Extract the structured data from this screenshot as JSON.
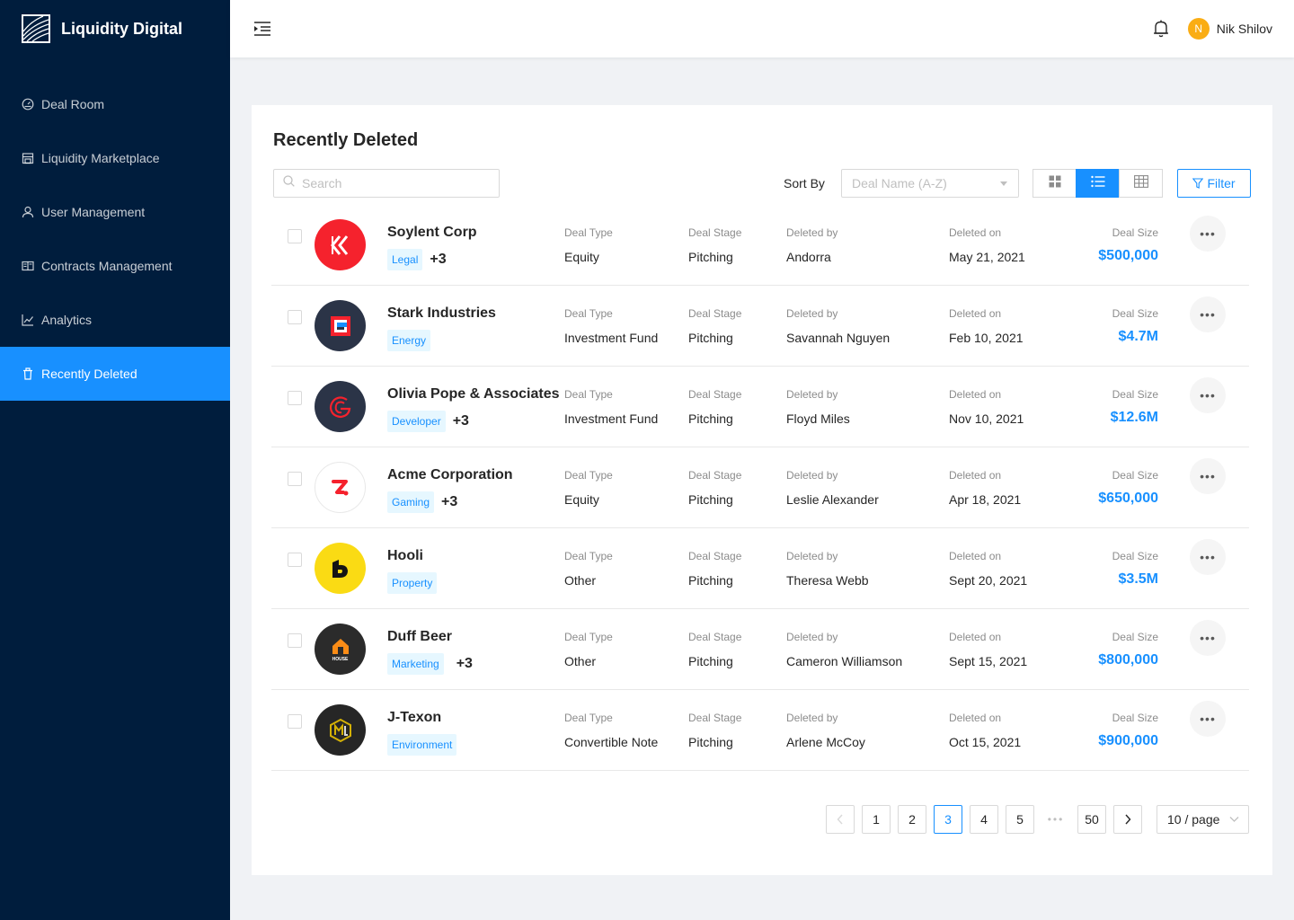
{
  "app": {
    "name": "Liquidity Digital"
  },
  "sidebar": {
    "items": [
      {
        "label": "Deal Room",
        "icon": "dashboard-icon"
      },
      {
        "label": "Liquidity Marketplace",
        "icon": "shop-icon"
      },
      {
        "label": "User Management",
        "icon": "user-icon"
      },
      {
        "label": "Contracts Management",
        "icon": "book-icon"
      },
      {
        "label": "Analytics",
        "icon": "line-chart-icon"
      },
      {
        "label": "Recently Deleted",
        "icon": "trash-icon",
        "active": true
      }
    ]
  },
  "header": {
    "user_initial": "N",
    "user_name": "Nik Shilov"
  },
  "page": {
    "title": "Recently Deleted",
    "search_placeholder": "Search",
    "sort_label": "Sort By",
    "sort_placeholder": "Deal Name (A-Z)",
    "filter_label": "Filter"
  },
  "columns": {
    "deal_type": "Deal Type",
    "deal_stage": "Deal Stage",
    "deleted_by": "Deleted by",
    "deleted_on": "Deleted on",
    "deal_size": "Deal Size"
  },
  "rows": [
    {
      "name": "Soylent Corp",
      "tag": "Legal",
      "more": "+3",
      "deal_type": "Equity",
      "deal_stage": "Pitching",
      "deleted_by": "Andorra",
      "deleted_on": "May 21, 2021",
      "deal_size": "$500,000"
    },
    {
      "name": "Stark Industries",
      "tag": "Energy",
      "more": "",
      "deal_type": "Investment Fund",
      "deal_stage": "Pitching",
      "deleted_by": "Savannah Nguyen",
      "deleted_on": "Feb 10, 2021",
      "deal_size": "$4.7M"
    },
    {
      "name": "Olivia Pope & Associates",
      "tag": "Developer",
      "more": "+3",
      "deal_type": "Investment Fund",
      "deal_stage": "Pitching",
      "deleted_by": "Floyd Miles",
      "deleted_on": "Nov 10, 2021",
      "deal_size": "$12.6M"
    },
    {
      "name": "Acme Corporation",
      "tag": "Gaming",
      "more": "+3",
      "deal_type": "Equity",
      "deal_stage": "Pitching",
      "deleted_by": "Leslie Alexander",
      "deleted_on": "Apr 18, 2021",
      "deal_size": "$650,000"
    },
    {
      "name": "Hooli",
      "tag": "Property",
      "more": "",
      "deal_type": "Other",
      "deal_stage": "Pitching",
      "deleted_by": "Theresa Webb",
      "deleted_on": "Sept 20, 2021",
      "deal_size": "$3.5M"
    },
    {
      "name": "Duff Beer",
      "tag": "Marketing",
      "more": "+3",
      "logo_text": "HOUSE",
      "deal_type": "Other",
      "deal_stage": "Pitching",
      "deleted_by": "Cameron Williamson",
      "deleted_on": "Sept 15, 2021",
      "deal_size": "$800,000"
    },
    {
      "name": "J-Texon",
      "tag": "Environment",
      "more": "",
      "deal_type": "Convertible Note",
      "deal_stage": "Pitching",
      "deleted_by": "Arlene McCoy",
      "deleted_on": "Oct 15, 2021",
      "deal_size": "$900,000"
    }
  ],
  "pagination": {
    "pages": [
      "1",
      "2",
      "3",
      "4",
      "5"
    ],
    "current": "3",
    "last": "50",
    "page_size": "10 / page"
  },
  "colors": {
    "primary": "#1890ff",
    "sidebar_bg": "#001d3d",
    "avatar": "#faad14"
  }
}
